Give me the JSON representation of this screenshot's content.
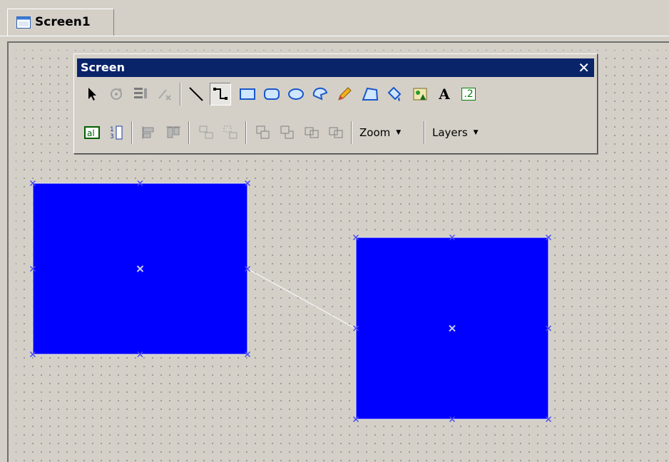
{
  "tab": {
    "label": "Screen1"
  },
  "toolbar": {
    "title": "Screen",
    "close_glyph": "✕",
    "text_tool_glyph": "A",
    "numeric_tool_glyph": ".2",
    "zoom_label": "Zoom",
    "layers_label": "Layers",
    "dropdown_arrow": "▼",
    "row1_icons": [
      "pointer-icon",
      "rotate-icon",
      "properties-icon",
      "disconnect-icon",
      "line-icon",
      "connector-icon",
      "rectangle-icon",
      "rounded-rectangle-icon",
      "ellipse-icon",
      "arc-icon",
      "pencil-icon",
      "polygon-icon",
      "fill-icon",
      "image-icon",
      "text-icon",
      "numeric-display-icon"
    ],
    "row2_icons": [
      "text-field-icon",
      "number-list-icon",
      "align-left-icon",
      "align-top-icon",
      "group-icon",
      "ungroup-icon",
      "bring-front-icon",
      "send-back-icon",
      "bring-forward-icon",
      "send-backward-icon"
    ],
    "active_tool": "connector-icon"
  },
  "colors": {
    "shape_fill": "#0000ff",
    "handle": "#4a4af0",
    "connector_line": "#e8e8e8",
    "title_bar": "#0a246a"
  }
}
